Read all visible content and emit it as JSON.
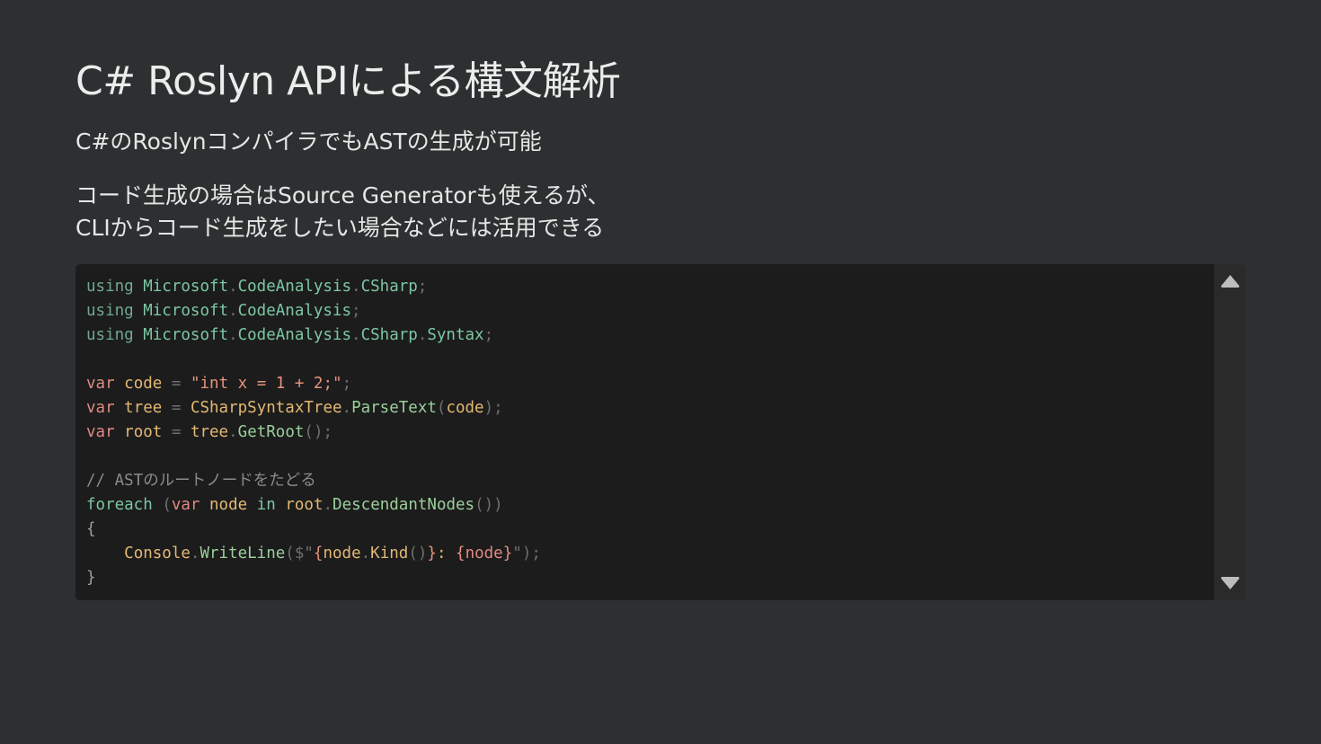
{
  "slide": {
    "title": "C# Roslyn APIによる構文解析",
    "subtitle": "C#のRoslynコンパイラでもASTの生成が可能",
    "paragraph": [
      "コード生成の場合はSource Generatorも使えるが、",
      "CLIからコード生成をしたい場合などには活用できる"
    ]
  },
  "code_block": {
    "language": "csharp",
    "lines": [
      [
        {
          "t": "using",
          "c": "kw-using"
        },
        {
          "t": " "
        },
        {
          "t": "Microsoft",
          "c": "ns"
        },
        {
          "t": ".",
          "c": "punc"
        },
        {
          "t": "CodeAnalysis",
          "c": "ns"
        },
        {
          "t": ".",
          "c": "punc"
        },
        {
          "t": "CSharp",
          "c": "ns"
        },
        {
          "t": ";",
          "c": "punc"
        }
      ],
      [
        {
          "t": "using",
          "c": "kw-using"
        },
        {
          "t": " "
        },
        {
          "t": "Microsoft",
          "c": "ns"
        },
        {
          "t": ".",
          "c": "punc"
        },
        {
          "t": "CodeAnalysis",
          "c": "ns"
        },
        {
          "t": ";",
          "c": "punc"
        }
      ],
      [
        {
          "t": "using",
          "c": "kw-using"
        },
        {
          "t": " "
        },
        {
          "t": "Microsoft",
          "c": "ns"
        },
        {
          "t": ".",
          "c": "punc"
        },
        {
          "t": "CodeAnalysis",
          "c": "ns"
        },
        {
          "t": ".",
          "c": "punc"
        },
        {
          "t": "CSharp",
          "c": "ns"
        },
        {
          "t": ".",
          "c": "punc"
        },
        {
          "t": "Syntax",
          "c": "ns"
        },
        {
          "t": ";",
          "c": "punc"
        }
      ],
      [],
      [
        {
          "t": "var",
          "c": "kw-var"
        },
        {
          "t": " "
        },
        {
          "t": "code",
          "c": "ident"
        },
        {
          "t": " "
        },
        {
          "t": "=",
          "c": "punc"
        },
        {
          "t": " "
        },
        {
          "t": "\"",
          "c": "str"
        },
        {
          "t": "int x = 1 + 2;",
          "c": "str"
        },
        {
          "t": "\"",
          "c": "str"
        },
        {
          "t": ";",
          "c": "punc"
        }
      ],
      [
        {
          "t": "var",
          "c": "kw-var"
        },
        {
          "t": " "
        },
        {
          "t": "tree",
          "c": "ident"
        },
        {
          "t": " "
        },
        {
          "t": "=",
          "c": "punc"
        },
        {
          "t": " "
        },
        {
          "t": "CSharpSyntaxTree",
          "c": "type"
        },
        {
          "t": ".",
          "c": "punc"
        },
        {
          "t": "ParseText",
          "c": "meth"
        },
        {
          "t": "(",
          "c": "punc"
        },
        {
          "t": "code",
          "c": "ident"
        },
        {
          "t": ");",
          "c": "punc"
        }
      ],
      [
        {
          "t": "var",
          "c": "kw-var"
        },
        {
          "t": " "
        },
        {
          "t": "root",
          "c": "ident"
        },
        {
          "t": " "
        },
        {
          "t": "=",
          "c": "punc"
        },
        {
          "t": " "
        },
        {
          "t": "tree",
          "c": "ident"
        },
        {
          "t": ".",
          "c": "punc"
        },
        {
          "t": "GetRoot",
          "c": "meth"
        },
        {
          "t": "();",
          "c": "punc"
        }
      ],
      [],
      [
        {
          "t": "// ASTのルートノードをたどる",
          "c": "cmt"
        }
      ],
      [
        {
          "t": "foreach",
          "c": "kw-ctl"
        },
        {
          "t": " "
        },
        {
          "t": "(",
          "c": "punc"
        },
        {
          "t": "var",
          "c": "kw-var"
        },
        {
          "t": " "
        },
        {
          "t": "node",
          "c": "ident"
        },
        {
          "t": " "
        },
        {
          "t": "in",
          "c": "kw-ctl"
        },
        {
          "t": " "
        },
        {
          "t": "root",
          "c": "ident"
        },
        {
          "t": ".",
          "c": "punc"
        },
        {
          "t": "DescendantNodes",
          "c": "meth"
        },
        {
          "t": "())",
          "c": "punc"
        }
      ],
      [
        {
          "t": "{",
          "c": "brace"
        }
      ],
      [
        {
          "t": "    "
        },
        {
          "t": "Console",
          "c": "type"
        },
        {
          "t": ".",
          "c": "punc"
        },
        {
          "t": "WriteLine",
          "c": "meth"
        },
        {
          "t": "(",
          "c": "punc"
        },
        {
          "t": "$\"",
          "c": "punc"
        },
        {
          "t": "{",
          "c": "str"
        },
        {
          "t": "node",
          "c": "ident"
        },
        {
          "t": ".",
          "c": "punc"
        },
        {
          "t": "Kind",
          "c": "ident"
        },
        {
          "t": "()",
          "c": "punc"
        },
        {
          "t": "}",
          "c": "str"
        },
        {
          "t": ": ",
          "c": "ident"
        },
        {
          "t": "{",
          "c": "str"
        },
        {
          "t": "node",
          "c": "interp"
        },
        {
          "t": "}",
          "c": "str"
        },
        {
          "t": "\");",
          "c": "punc"
        }
      ],
      [
        {
          "t": "}",
          "c": "brace"
        }
      ]
    ]
  },
  "scrollbar": {
    "up_icon": "triangle-up-icon",
    "down_icon": "triangle-down-icon",
    "color": "#bdbdbd"
  },
  "colors": {
    "background": "#2d3031",
    "code_background": "#1c1c1c"
  }
}
